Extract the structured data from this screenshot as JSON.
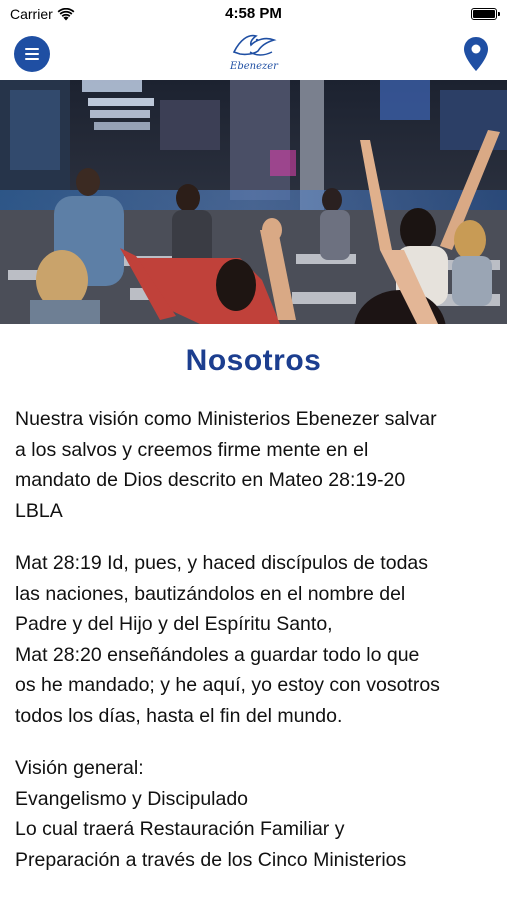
{
  "status_bar": {
    "carrier": "Carrier",
    "time": "4:58 PM"
  },
  "header": {
    "menu_icon": "hamburger-menu-icon",
    "logo_text": "Ebenezer",
    "location_icon": "map-pin-icon",
    "accent_color": "#1f4fa3"
  },
  "hero": {
    "image": "church-congregation-worship-photo"
  },
  "main": {
    "title": "Nosotros",
    "title_color": "#1c3e8f",
    "paragraphs": [
      {
        "lines": [
          "Nuestra visión como Ministerios Ebenezer salvar",
          "a los salvos y creemos firme mente en el",
          "mandato de Dios descrito en Mateo 28:19-20",
          "LBLA"
        ]
      },
      {
        "lines": [
          "Mat 28:19  Id, pues, y haced discípulos de todas",
          "las naciones, bautizándolos en el nombre del",
          "Padre y del Hijo y del Espíritu Santo,",
          "Mat 28:20  enseñándoles a guardar todo lo que",
          "os he mandado; y he aquí, yo estoy con vosotros",
          "todos los días, hasta el fin del mundo."
        ]
      },
      {
        "lines": [
          "Visión general:",
          "Evangelismo y Discipulado",
          "Lo cual traerá Restauración Familiar y",
          "Preparación a través de los Cinco Ministerios"
        ]
      }
    ]
  }
}
